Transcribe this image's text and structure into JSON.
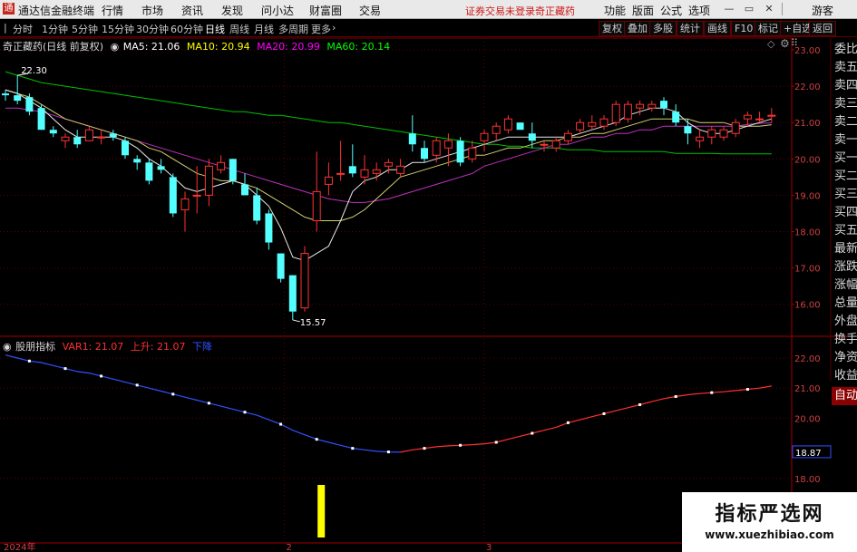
{
  "menubar": {
    "app_title": "通达信金融终端",
    "menus": [
      "行情",
      "市场",
      "资讯",
      "发现",
      "问小达",
      "财富圈",
      "交易"
    ],
    "warning": "证券交易未登录",
    "stock_name": "奇正藏药",
    "right": [
      "功能",
      "版面",
      "公式",
      "选项"
    ],
    "guest": "游客"
  },
  "toolbar": {
    "periods": [
      "分时",
      "1分钟",
      "5分钟",
      "15分钟",
      "30分钟",
      "60分钟",
      "日线",
      "周线",
      "月线",
      "多周期",
      "更多"
    ],
    "selected": "日线",
    "right_buttons": [
      "复权",
      "叠加",
      "多股",
      "统计",
      "画线",
      "F10",
      "标记",
      "+自选",
      "返回"
    ]
  },
  "main_legend": {
    "title": "奇正藏药(日线 前复权)",
    "ma5": "MA5: 21.06",
    "ma10": "MA10: 20.94",
    "ma20": "MA20: 20.99",
    "ma60": "MA60: 20.14",
    "colors": {
      "ma5": "#ffffff",
      "ma10": "#ffff00",
      "ma20": "#ff00ff",
      "ma60": "#00ff00"
    }
  },
  "sub_legend": {
    "title": "股朋指标",
    "var1": "VAR1: 21.07",
    "up": "上升: 21.07",
    "down": "下降"
  },
  "price_axis": [
    "23.00",
    "22.00",
    "21.00",
    "20.00",
    "19.00",
    "18.00",
    "17.00",
    "16.00"
  ],
  "sub_axis": [
    "22.00",
    "21.00",
    "20.00",
    "18.00"
  ],
  "sub_current": "18.87",
  "annotations": {
    "high": "22.30",
    "low": "15.57"
  },
  "date_axis": [
    "2024年",
    "2",
    "3"
  ],
  "sidebar": [
    "委比",
    "卖五",
    "卖四",
    "卖三",
    "卖二",
    "卖一",
    "买一",
    "买二",
    "买三",
    "买四",
    "买五",
    "最新",
    "涨跌",
    "涨幅",
    "总量",
    "外盘",
    "换手",
    "净资",
    "收益"
  ],
  "sidebar_auto": "自动",
  "watermark": {
    "title": "指标严选网",
    "url": "www.xuezhibiao.com"
  },
  "chart_data": {
    "type": "candlestick",
    "ylim": [
      15.4,
      23.3
    ],
    "candles": [
      [
        21.8,
        21.9,
        21.6,
        21.75
      ],
      [
        21.75,
        22.3,
        21.5,
        21.6
      ],
      [
        21.7,
        21.8,
        21.2,
        21.3
      ],
      [
        21.4,
        21.5,
        20.8,
        20.8
      ],
      [
        20.8,
        20.9,
        20.6,
        20.7
      ],
      [
        20.5,
        20.7,
        20.3,
        20.6
      ],
      [
        20.6,
        20.8,
        20.3,
        20.4
      ],
      [
        20.5,
        20.9,
        20.5,
        20.8
      ],
      [
        20.6,
        20.8,
        20.4,
        20.6
      ],
      [
        20.7,
        20.8,
        20.5,
        20.6
      ],
      [
        20.5,
        20.6,
        20.0,
        20.1
      ],
      [
        20.0,
        20.1,
        19.7,
        19.9
      ],
      [
        19.9,
        20.0,
        19.3,
        19.4
      ],
      [
        19.8,
        20.0,
        19.6,
        19.7
      ],
      [
        19.5,
        19.6,
        18.4,
        18.5
      ],
      [
        18.6,
        19.1,
        18.0,
        18.9
      ],
      [
        19.0,
        19.8,
        18.5,
        19.0
      ],
      [
        19.0,
        20.0,
        18.7,
        19.8
      ],
      [
        19.7,
        20.1,
        19.6,
        19.9
      ],
      [
        20.0,
        20.0,
        19.3,
        19.4
      ],
      [
        19.3,
        19.6,
        19.0,
        19.0
      ],
      [
        19.0,
        19.2,
        18.2,
        18.3
      ],
      [
        18.5,
        18.6,
        17.5,
        17.7
      ],
      [
        17.4,
        17.4,
        16.6,
        16.7
      ],
      [
        16.8,
        16.8,
        15.57,
        15.8
      ],
      [
        15.9,
        17.6,
        15.8,
        17.4
      ],
      [
        18.3,
        20.2,
        18.0,
        19.1
      ],
      [
        19.3,
        19.9,
        19.0,
        19.5
      ],
      [
        19.6,
        20.5,
        19.4,
        19.6
      ],
      [
        19.8,
        20.4,
        19.5,
        19.6
      ],
      [
        19.5,
        20.1,
        19.3,
        19.7
      ],
      [
        19.6,
        19.9,
        19.4,
        19.7
      ],
      [
        19.8,
        20.0,
        19.6,
        19.9
      ],
      [
        19.6,
        20.0,
        19.5,
        19.8
      ],
      [
        20.7,
        21.2,
        20.2,
        20.4
      ],
      [
        20.3,
        20.5,
        19.9,
        20.0
      ],
      [
        20.1,
        20.6,
        19.9,
        20.5
      ],
      [
        20.3,
        20.7,
        19.8,
        20.5
      ],
      [
        20.5,
        20.6,
        19.8,
        19.9
      ],
      [
        20.0,
        20.5,
        19.9,
        20.3
      ],
      [
        20.5,
        20.8,
        20.2,
        20.7
      ],
      [
        20.7,
        21.0,
        20.5,
        20.9
      ],
      [
        20.8,
        21.2,
        20.7,
        21.1
      ],
      [
        21.0,
        21.0,
        20.8,
        20.8
      ],
      [
        20.7,
        21.0,
        20.3,
        20.5
      ],
      [
        20.4,
        20.5,
        20.2,
        20.4
      ],
      [
        20.3,
        20.6,
        20.2,
        20.5
      ],
      [
        20.5,
        20.8,
        20.4,
        20.7
      ],
      [
        20.8,
        21.1,
        20.7,
        21.0
      ],
      [
        20.9,
        21.2,
        20.8,
        21.0
      ],
      [
        20.9,
        21.2,
        20.8,
        21.1
      ],
      [
        21.0,
        21.6,
        20.9,
        21.5
      ],
      [
        21.1,
        21.6,
        21.0,
        21.5
      ],
      [
        21.4,
        21.6,
        21.2,
        21.5
      ],
      [
        21.4,
        21.6,
        21.3,
        21.5
      ],
      [
        21.6,
        21.7,
        21.2,
        21.4
      ],
      [
        21.3,
        21.5,
        20.9,
        21.0
      ],
      [
        20.9,
        21.1,
        20.4,
        20.7
      ],
      [
        20.5,
        20.8,
        20.3,
        20.6
      ],
      [
        20.6,
        20.9,
        20.4,
        20.8
      ],
      [
        20.6,
        20.9,
        20.5,
        20.8
      ],
      [
        20.7,
        21.1,
        20.6,
        21.0
      ],
      [
        21.1,
        21.3,
        20.9,
        21.2
      ],
      [
        21.1,
        21.3,
        21.0,
        21.1
      ],
      [
        21.2,
        21.4,
        21.0,
        21.2
      ]
    ],
    "ma5": [
      21.9,
      21.8,
      21.6,
      21.4,
      21.1,
      20.8,
      20.6,
      20.6,
      20.6,
      20.6,
      20.5,
      20.3,
      20.0,
      19.8,
      19.5,
      19.2,
      19.1,
      19.2,
      19.3,
      19.4,
      19.3,
      19.0,
      18.7,
      18.1,
      17.3,
      17.2,
      17.4,
      17.6,
      18.3,
      19.1,
      19.4,
      19.5,
      19.7,
      19.7,
      19.9,
      19.9,
      20.0,
      20.1,
      20.2,
      20.3,
      20.4,
      20.5,
      20.6,
      20.6,
      20.6,
      20.6,
      20.6,
      20.6,
      20.7,
      20.8,
      20.9,
      21.0,
      21.2,
      21.3,
      21.4,
      21.4,
      21.3,
      21.0,
      20.8,
      20.7,
      20.7,
      20.8,
      20.9,
      21.0,
      21.1
    ],
    "ma10": [
      21.9,
      21.8,
      21.7,
      21.5,
      21.3,
      21.1,
      21.0,
      20.9,
      20.8,
      20.7,
      20.6,
      20.5,
      20.3,
      20.2,
      20.0,
      19.8,
      19.6,
      19.5,
      19.4,
      19.4,
      19.3,
      19.2,
      19.0,
      18.8,
      18.6,
      18.4,
      18.3,
      18.3,
      18.3,
      18.4,
      18.6,
      18.9,
      19.2,
      19.5,
      19.6,
      19.7,
      19.8,
      19.9,
      20.0,
      20.1,
      20.1,
      20.2,
      20.3,
      20.3,
      20.4,
      20.5,
      20.5,
      20.6,
      20.6,
      20.7,
      20.7,
      20.8,
      20.9,
      21.0,
      21.1,
      21.1,
      21.1,
      21.1,
      21.0,
      21.0,
      21.0,
      20.9,
      20.9,
      20.9,
      20.94
    ],
    "ma20": [
      21.4,
      21.4,
      21.35,
      21.3,
      21.2,
      21.1,
      21.0,
      20.9,
      20.8,
      20.7,
      20.6,
      20.5,
      20.4,
      20.3,
      20.2,
      20.1,
      20.0,
      19.9,
      19.8,
      19.7,
      19.6,
      19.5,
      19.4,
      19.3,
      19.2,
      19.1,
      19.0,
      18.9,
      18.85,
      18.8,
      18.8,
      18.85,
      18.9,
      19.0,
      19.1,
      19.2,
      19.3,
      19.4,
      19.5,
      19.6,
      19.8,
      19.9,
      20.0,
      20.1,
      20.2,
      20.3,
      20.4,
      20.4,
      20.5,
      20.6,
      20.6,
      20.7,
      20.7,
      20.8,
      20.8,
      20.9,
      20.9,
      20.9,
      20.9,
      20.9,
      20.9,
      20.9,
      20.95,
      20.98,
      20.99
    ],
    "ma60": [
      22.4,
      22.3,
      22.2,
      22.1,
      22.05,
      22.0,
      21.95,
      21.9,
      21.85,
      21.8,
      21.75,
      21.7,
      21.65,
      21.6,
      21.55,
      21.5,
      21.45,
      21.4,
      21.35,
      21.3,
      21.3,
      21.25,
      21.2,
      21.2,
      21.15,
      21.1,
      21.05,
      21.0,
      21.0,
      20.95,
      20.9,
      20.85,
      20.8,
      20.75,
      20.7,
      20.65,
      20.6,
      20.55,
      20.5,
      20.45,
      20.4,
      20.4,
      20.35,
      20.35,
      20.3,
      20.3,
      20.3,
      20.25,
      20.25,
      20.25,
      20.2,
      20.2,
      20.2,
      20.2,
      20.2,
      20.2,
      20.15,
      20.15,
      20.15,
      20.15,
      20.14,
      20.14,
      20.14,
      20.14,
      20.14
    ],
    "sub_ylim": [
      17.6,
      22.6
    ],
    "var1": [
      22.1,
      22.0,
      21.9,
      21.85,
      21.75,
      21.65,
      21.55,
      21.5,
      21.4,
      21.3,
      21.2,
      21.1,
      21.0,
      20.9,
      20.8,
      20.7,
      20.6,
      20.5,
      20.4,
      20.3,
      20.2,
      20.1,
      19.95,
      19.8,
      19.6,
      19.45,
      19.3,
      19.2,
      19.1,
      19.0,
      18.95,
      18.9,
      18.88,
      18.87,
      18.95,
      19.0,
      19.05,
      19.08,
      19.1,
      19.12,
      19.15,
      19.2,
      19.3,
      19.4,
      19.5,
      19.6,
      19.7,
      19.85,
      19.95,
      20.05,
      20.15,
      20.25,
      20.35,
      20.45,
      20.55,
      20.65,
      20.72,
      20.78,
      20.82,
      20.85,
      20.88,
      20.92,
      20.96,
      21.0,
      21.07
    ],
    "turn_index": 33
  }
}
